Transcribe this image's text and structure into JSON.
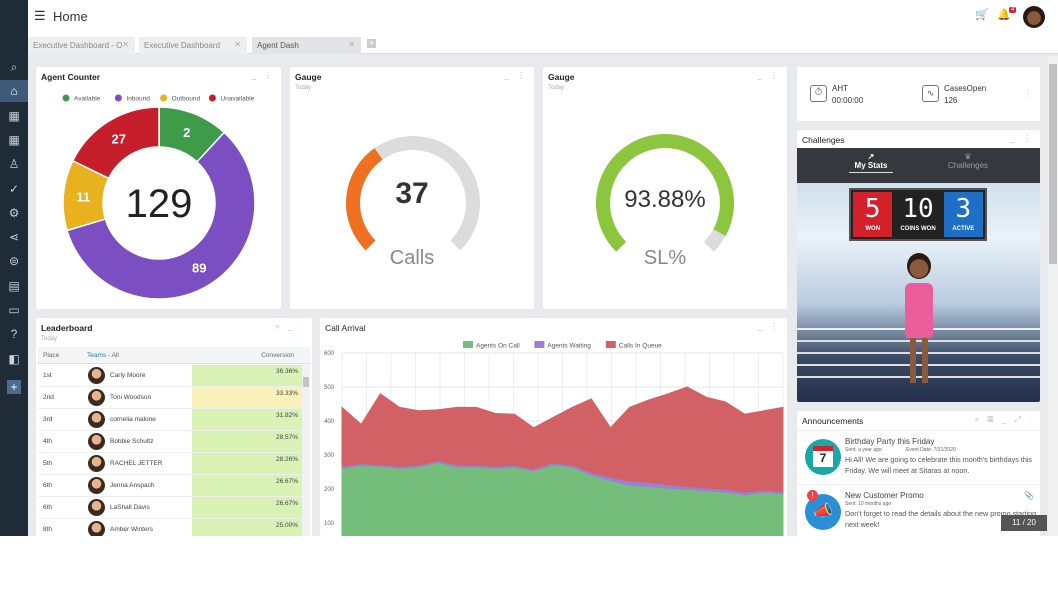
{
  "header": {
    "title": "Home",
    "cart_icon": "cart-icon",
    "notification_count": "4"
  },
  "tabs": [
    {
      "label": "Executive Dashboard - O"
    },
    {
      "label": "Executive Dashboard"
    },
    {
      "label": "Agent Dash",
      "active": true
    }
  ],
  "sidebar": {
    "icons": [
      "search-icon",
      "home-icon",
      "dashboard-icon",
      "widgets-icon",
      "user-icon",
      "check-icon",
      "settings-person-icon",
      "share-icon",
      "gamepad-icon",
      "clipboard-icon",
      "monitor-icon",
      "help-icon",
      "layout-icon",
      "add-icon"
    ]
  },
  "agent_counter": {
    "title": "Agent Counter",
    "total": "129"
  },
  "gauge1": {
    "title": "Gauge",
    "subtitle": "Today",
    "value": "37",
    "label": "Calls",
    "percent": 37,
    "color": "#f07022"
  },
  "gauge2": {
    "title": "Gauge",
    "subtitle": "Today",
    "value": "93.88%",
    "label": "SL%",
    "percent": 93.88,
    "color": "#8cc63f"
  },
  "kpis": [
    {
      "label": "AHT",
      "value": "00:00:00",
      "icon": "stopwatch-icon"
    },
    {
      "label": "CasesOpen",
      "value": "126",
      "icon": "trend-icon"
    }
  ],
  "challenges": {
    "title": "Challenges",
    "tabs": [
      "My Stats",
      "Challenges"
    ],
    "scoreboard": [
      {
        "value": "5",
        "label": "WON",
        "color": "#d4202a"
      },
      {
        "value": "10",
        "label": "COINS WON",
        "color": "#222"
      },
      {
        "value": "3",
        "label": "ACTIVE",
        "color": "#1f6fc6"
      }
    ]
  },
  "leaderboard": {
    "title": "Leaderboard",
    "subtitle": "Today",
    "columns": {
      "place": "Place",
      "teams": "Teams",
      "teams_filter": " - All",
      "conversion": "Conversion"
    },
    "rows": [
      {
        "place": "1st",
        "name": "Carly Moore",
        "conversion": "36.36%",
        "color": "#d8f2b5"
      },
      {
        "place": "2nd",
        "name": "Toni Woodson",
        "conversion": "33.33%",
        "color": "#f8f1b8"
      },
      {
        "place": "3rd",
        "name": "cornelia malone",
        "conversion": "31.82%",
        "color": "#d8f2b5"
      },
      {
        "place": "4th",
        "name": "Bobbie Schultz",
        "conversion": "28.57%",
        "color": "#d8f2b5"
      },
      {
        "place": "5th",
        "name": "RACHEL JETTER",
        "conversion": "28.26%",
        "color": "#d8f2b5"
      },
      {
        "place": "6th",
        "name": "Jenna Anspach",
        "conversion": "26.67%",
        "color": "#d8f2b5"
      },
      {
        "place": "6th",
        "name": "LaShall Davis",
        "conversion": "26.67%",
        "color": "#d8f2b5"
      },
      {
        "place": "8th",
        "name": "Amber Winters",
        "conversion": "25.00%",
        "color": "#d8f2b5"
      }
    ]
  },
  "announcements": {
    "title": "Announcements",
    "items": [
      {
        "title": "Birthday Party this Friday",
        "sent": "Sent: a year ago",
        "event": "Event Date: 7/31/2020",
        "body": "Hi All! We are going to celebrate this month's birthdays this Friday. We will meet at Sitaras at noon.",
        "icon": "calendar-icon",
        "day": "7"
      },
      {
        "title": "New Customer Promo",
        "sent": "Sent: 10 months ago",
        "body": "Don't forget to read the details about the new promo starting next week!",
        "icon": "megaphone-icon"
      }
    ]
  },
  "pager": "11 / 20",
  "chart_data": [
    {
      "type": "pie",
      "title": "Agent Counter",
      "categories": [
        "Available",
        "Inbound",
        "Outbound",
        "Unavailable"
      ],
      "values": [
        2,
        89,
        11,
        27
      ],
      "colors": [
        "#3d9b4a",
        "#7b4fc1",
        "#e7b21d",
        "#c61f2b"
      ],
      "legend": "top"
    },
    {
      "type": "area",
      "stacked": true,
      "title": "Call Arrival",
      "ylim": [
        100,
        600
      ],
      "yticks": [
        100,
        200,
        300,
        400,
        500,
        600
      ],
      "grid": true,
      "legend": "top",
      "series": [
        {
          "name": "Agents On Call",
          "color": "#74bd7a",
          "values": [
            258,
            266,
            264,
            258,
            262,
            275,
            262,
            262,
            258,
            262,
            250,
            268,
            262,
            238,
            222,
            208,
            205,
            200,
            196,
            192,
            188,
            180,
            188,
            183
          ]
        },
        {
          "name": "Agents Waiting",
          "color": "#9b7fd9",
          "values": [
            6,
            6,
            4,
            6,
            5,
            5,
            6,
            5,
            6,
            5,
            6,
            6,
            6,
            8,
            10,
            12,
            12,
            10,
            8,
            8,
            8,
            8,
            6,
            6
          ]
        },
        {
          "name": "Calls In Queue",
          "color": "#d26165",
          "values": [
            176,
            118,
            212,
            176,
            163,
            153,
            172,
            173,
            158,
            153,
            124,
            136,
            172,
            219,
            148,
            220,
            245,
            270,
            296,
            270,
            260,
            232,
            236,
            251
          ]
        }
      ]
    }
  ]
}
